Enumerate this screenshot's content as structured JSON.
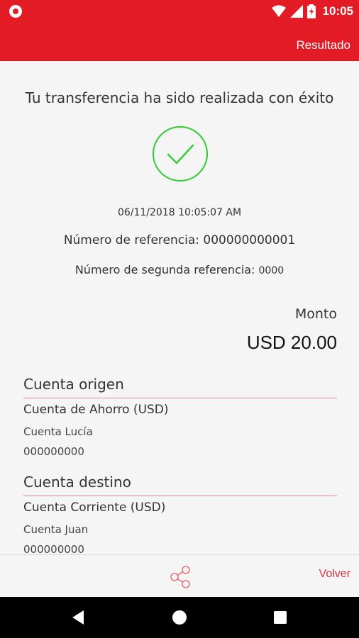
{
  "status_bar": {
    "time": "10:05"
  },
  "app_bar": {
    "title": "Resultado"
  },
  "result": {
    "message": "Tu transferencia ha sido realizada con éxito",
    "datetime": "06/11/2018 10:05:07 AM",
    "reference_label": "Número de referencia:",
    "reference_value": "000000000001",
    "second_reference_label": "Número de segunda referencia:",
    "second_reference_value": "0000"
  },
  "amount": {
    "label": "Monto",
    "value": "USD 20.00"
  },
  "origin": {
    "title": "Cuenta origen",
    "type": "Cuenta de Ahorro (USD)",
    "name": "Cuenta Lucía",
    "number": "000000000"
  },
  "destination": {
    "title": "Cuenta destino",
    "type": "Cuenta Corriente (USD)",
    "name": "Cuenta Juan",
    "number": "000000000"
  },
  "actions": {
    "back_label": "Volver"
  },
  "colors": {
    "brand": "#e21b25",
    "success": "#3dcc3d",
    "accent_text": "#d9333d"
  }
}
